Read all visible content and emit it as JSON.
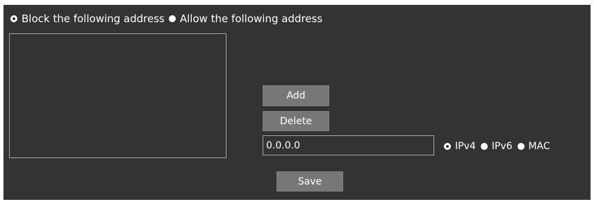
{
  "filter_mode": {
    "options": [
      {
        "label": "Block the following address",
        "checked": true
      },
      {
        "label": "Allow the following address",
        "checked": false
      }
    ]
  },
  "buttons": {
    "add": "Add",
    "delete": "Delete",
    "save": "Save"
  },
  "address_input": {
    "value": "0.0.0.0"
  },
  "address_type": {
    "options": [
      {
        "label": "IPv4",
        "checked": true
      },
      {
        "label": "IPv6",
        "checked": false
      },
      {
        "label": "MAC",
        "checked": false
      }
    ]
  },
  "colors": {
    "panel_bg": "#333333",
    "button_bg": "#777777",
    "border": "#a5a5a5",
    "text": "#ffffff"
  }
}
